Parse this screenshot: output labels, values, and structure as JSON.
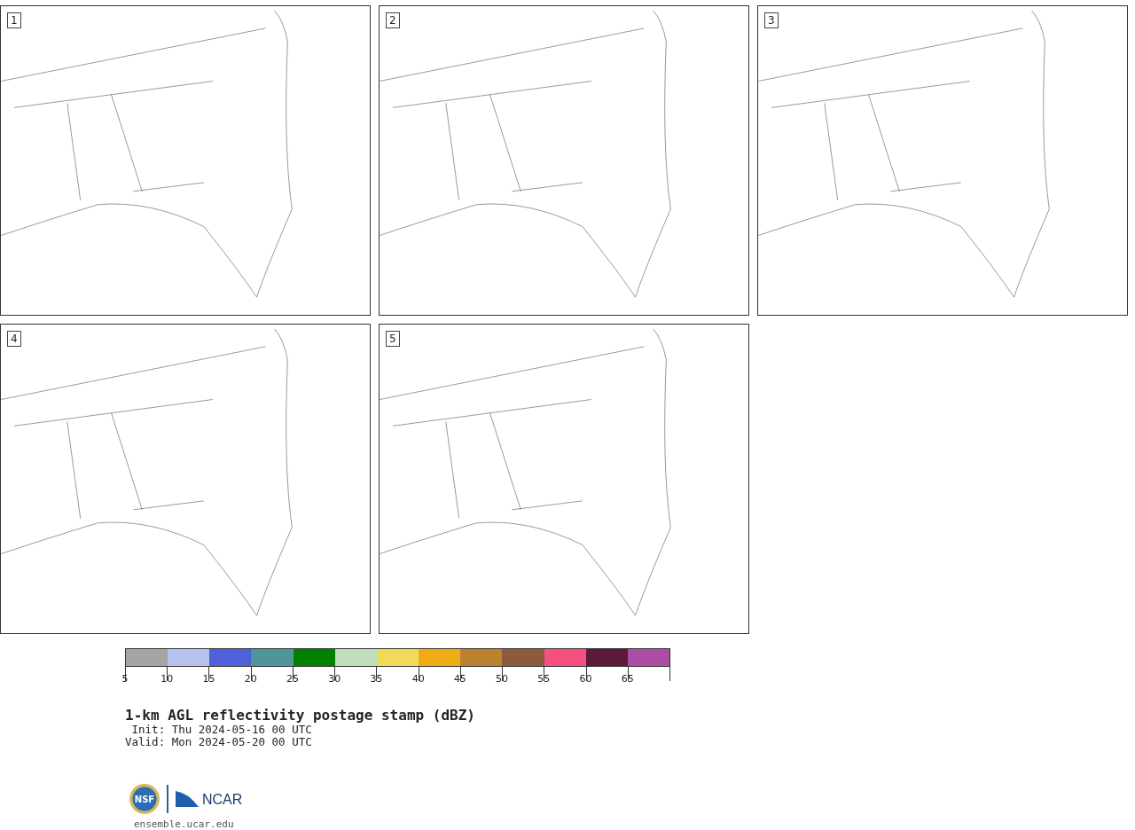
{
  "panels": [
    {
      "number": "1"
    },
    {
      "number": "2"
    },
    {
      "number": "3"
    },
    {
      "number": "4"
    },
    {
      "number": "5"
    }
  ],
  "colorbar": {
    "segments": [
      {
        "color": "#a5a5a5",
        "tick": "5"
      },
      {
        "color": "#b7c3ec",
        "tick": "10"
      },
      {
        "color": "#5060d8",
        "tick": "15"
      },
      {
        "color": "#4f969a",
        "tick": "20"
      },
      {
        "color": "#008200",
        "tick": "25"
      },
      {
        "color": "#bfdcbd",
        "tick": "30"
      },
      {
        "color": "#f0da5a",
        "tick": "35"
      },
      {
        "color": "#f0ac16",
        "tick": "40"
      },
      {
        "color": "#ba822e",
        "tick": "45"
      },
      {
        "color": "#8c5b3e",
        "tick": "50"
      },
      {
        "color": "#f45080",
        "tick": "55"
      },
      {
        "color": "#5e1838",
        "tick": "60"
      },
      {
        "color": "#ac4ca4",
        "tick": "65"
      }
    ]
  },
  "title": "1-km AGL reflectivity postage stamp (dBZ)",
  "init": " Init: Thu 2024-05-16 00 UTC",
  "valid": "Valid: Mon 2024-05-20 00 UTC",
  "footer": {
    "nsf_logo": "NSF",
    "ncar_logo": "NCAR",
    "url": "ensemble.ucar.edu"
  }
}
